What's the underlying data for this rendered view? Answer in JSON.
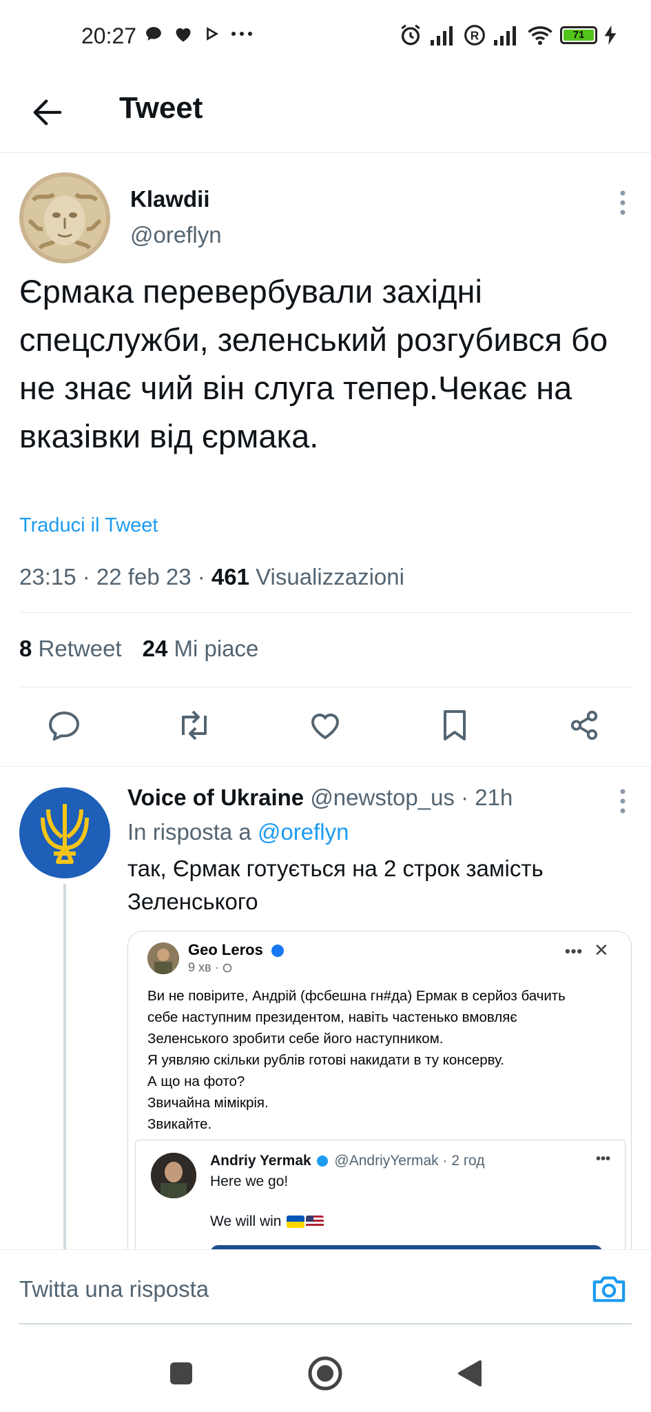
{
  "status_bar": {
    "time": "20:27",
    "left_icons": [
      "chat-bubble-icon",
      "heart-icon",
      "play-icon",
      "more-dots-icon"
    ],
    "right_icons": [
      "alarm-icon",
      "signal-icon",
      "roaming-icon",
      "signal-icon",
      "wifi-icon",
      "battery-icon",
      "charging-icon"
    ],
    "battery": "71",
    "battery_color": "#52c41a"
  },
  "header": {
    "title": "Tweet",
    "back_icon": "arrow-left-icon"
  },
  "main_tweet": {
    "display_name": "Klawdii",
    "handle": "@oreflyn",
    "text": "Єрмака перевербували західні спецслужби, зеленський розгубився бо не знає чий він слуга тепер.Чекає на вказівки від єрмака.",
    "translate_label": "Traduci il Tweet",
    "time": "23:15",
    "date": "22 feb 23",
    "views_count": "461",
    "views_label": "Visualizzazioni",
    "retweets_count": "8",
    "retweets_label": "Retweet",
    "likes_count": "24",
    "likes_label": "Mi piace",
    "actions": [
      "reply-icon",
      "retweet-icon",
      "like-icon",
      "bookmark-icon",
      "share-icon"
    ]
  },
  "reply": {
    "display_name": "Voice of Ukraine",
    "handle": "@newstop_us",
    "age": "21h",
    "reply_to_label": "In risposta a",
    "reply_to_handle": "@oreflyn",
    "text": "так, Єрмак готується на 2 строк замість Зеленського",
    "embedded_image": {
      "fb_name": "Geo Leros",
      "fb_time": "9 хв ·",
      "fb_text": "Ви не повірите, Андрій (фсбешна гн#да) Ермак в серйоз бачить\nсебе наступним президентом, навіть частенько вмовляє\nЗеленського зробити себе його наступником.\nЯ уявляю скільки рублів готові накидати в ту консерву.\nА що на фото?\nЗвичайна мімікрія.\nЗвикайте.",
      "quote_name": "Andriy Yermak",
      "quote_handle": "@AndriyYermak",
      "quote_age": "2 год",
      "quote_text1": "Here we go!",
      "quote_text2": "We will win"
    }
  },
  "compose": {
    "placeholder": "Twitta una risposta",
    "camera_icon": "camera-icon",
    "accent": "#1d9bf0"
  },
  "android_nav": [
    "recents-square-icon",
    "home-circle-icon",
    "back-triangle-icon"
  ]
}
